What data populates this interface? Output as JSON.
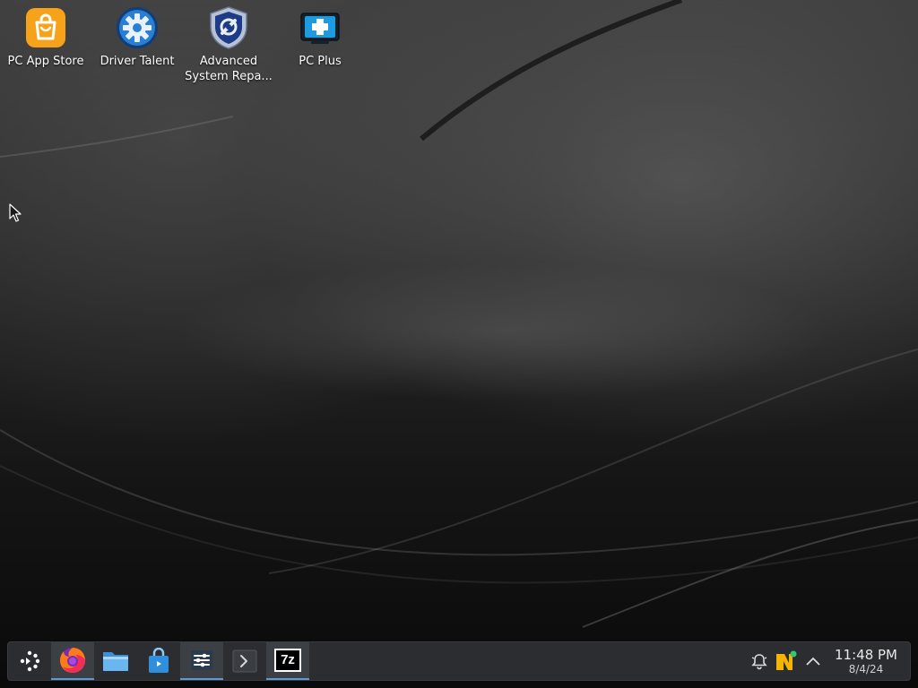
{
  "desktop": {
    "icons": [
      {
        "label": "PC App Store",
        "icon": "shopping-bag-icon",
        "color": "#f5a623"
      },
      {
        "label": "Driver Talent",
        "icon": "gear-icon",
        "color": "#2a7fd4"
      },
      {
        "label": "Advanced\nSystem Repa...",
        "icon": "shield-wrench-icon",
        "color": "#2c4a8f"
      },
      {
        "label": "PC Plus",
        "icon": "medical-cross-icon",
        "color": "#1e9be0"
      }
    ]
  },
  "taskbar": {
    "apps": [
      {
        "name": "app-launcher",
        "icon": "launcher-icon"
      },
      {
        "name": "firefox",
        "icon": "firefox-icon",
        "active": true
      },
      {
        "name": "file-manager",
        "icon": "folder-icon"
      },
      {
        "name": "discover-store",
        "icon": "store-bag-icon"
      },
      {
        "name": "system-settings",
        "icon": "sliders-icon"
      },
      {
        "name": "terminal",
        "icon": "terminal-icon"
      },
      {
        "name": "7zip",
        "icon": "7z-icon",
        "text": "7z"
      }
    ],
    "tray": {
      "icons": [
        "notifications-bell-icon",
        "updates-icon",
        "expand-tray-icon"
      ]
    },
    "clock": {
      "time": "11:48 PM",
      "date": "8/4/24"
    }
  },
  "colors": {
    "taskbar_bg": "#2b2d30",
    "accent": "#5a9ad8"
  }
}
